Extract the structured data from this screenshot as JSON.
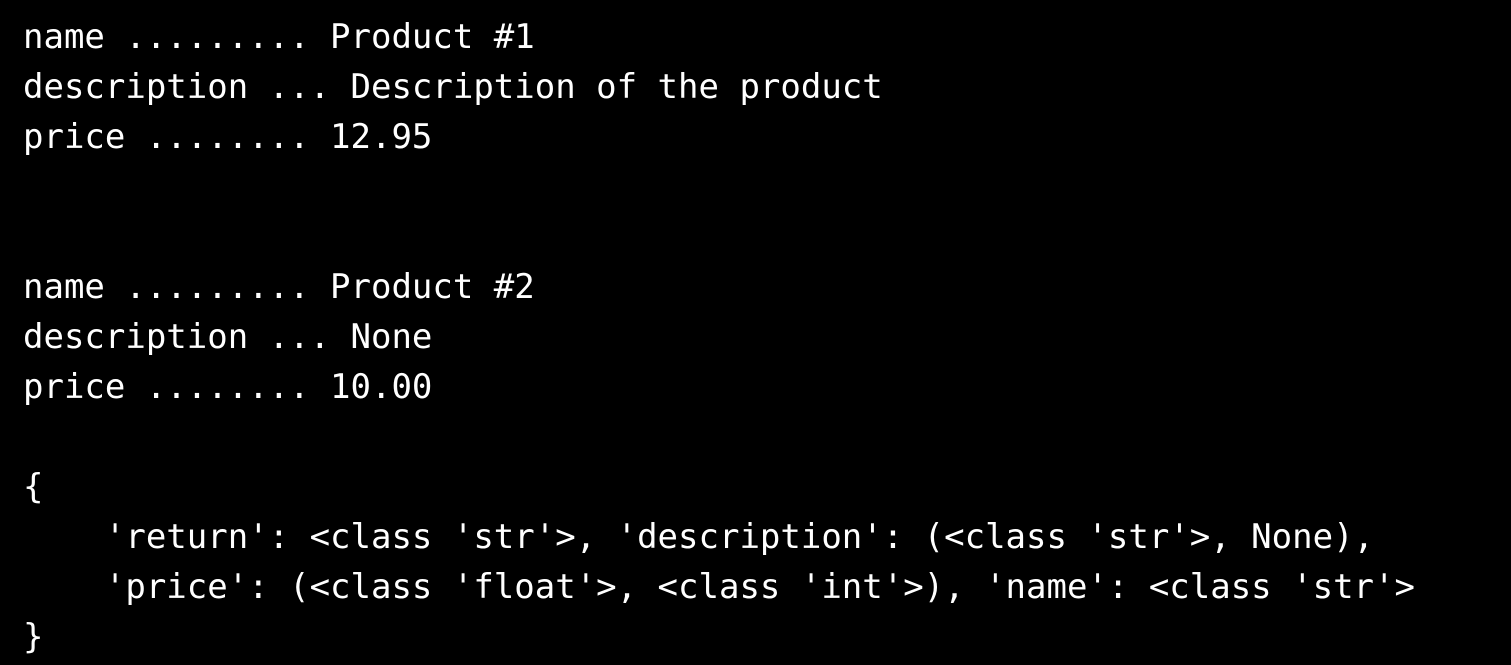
{
  "terminal": {
    "background": "#000000",
    "foreground": "#ffffff",
    "lines": [
      "name ......... Product #1",
      "description ... Description of the product",
      "price ........ 12.95",
      "",
      "",
      "name ......... Product #2",
      "description ... None",
      "price ........ 10.00",
      "",
      "{",
      "    'return': <class 'str'>, 'description': (<class 'str'>, None),",
      "    'price': (<class 'float'>, <class 'int'>), 'name': <class 'str'>",
      "}"
    ]
  }
}
